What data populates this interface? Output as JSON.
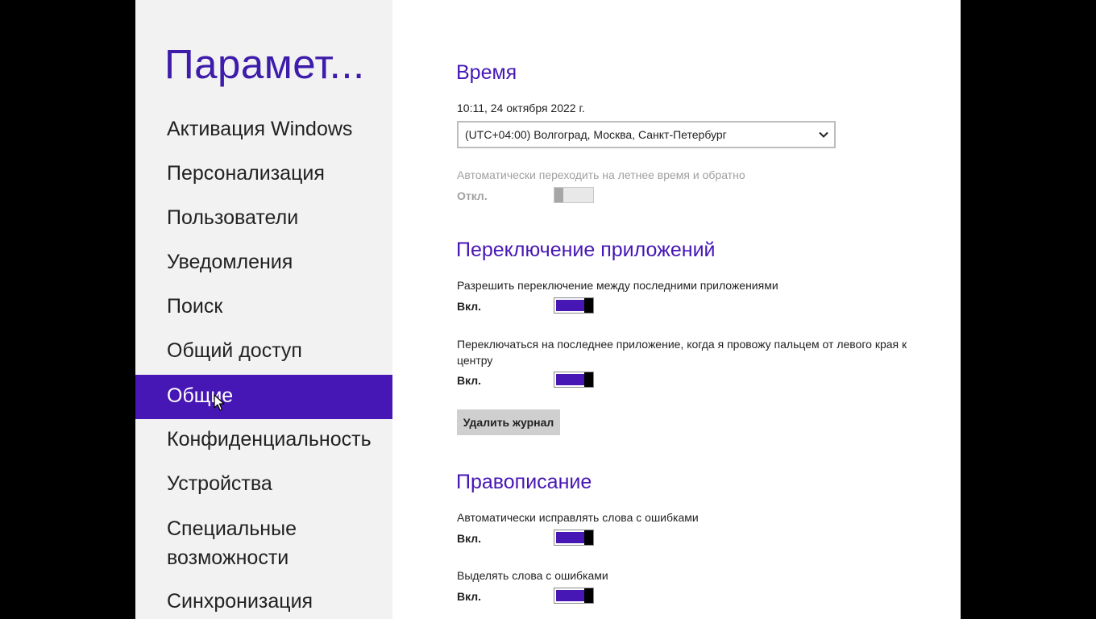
{
  "nav": {
    "title": "Парамет...",
    "items": [
      {
        "label": "Активация Windows"
      },
      {
        "label": "Персонализация"
      },
      {
        "label": "Пользователи"
      },
      {
        "label": "Уведомления"
      },
      {
        "label": "Поиск"
      },
      {
        "label": "Общий доступ"
      },
      {
        "label": "Общие",
        "selected": true
      },
      {
        "label": "Конфиденциальность"
      },
      {
        "label": "Устройства"
      },
      {
        "label": "Специальные возможности"
      },
      {
        "label": "Синхронизация"
      }
    ]
  },
  "time": {
    "heading": "Время",
    "current": "10:11, 24 октября 2022 г.",
    "timezone": "(UTC+04:00) Волгоград, Москва, Санкт-Петербург",
    "dst_label": "Автоматически переходить на летнее время и обратно",
    "dst_state": "Откл."
  },
  "app_switch": {
    "heading": "Переключение приложений",
    "allow_label": "Разрешить переключение между последними приложениями",
    "allow_state": "Вкл.",
    "swipe_label": "Переключаться на последнее приложение, когда я провожу пальцем от левого края к центру",
    "swipe_state": "Вкл.",
    "clear_button": "Удалить журнал"
  },
  "spelling": {
    "heading": "Правописание",
    "autocorrect_label": "Автоматически исправлять слова с ошибками",
    "autocorrect_state": "Вкл.",
    "highlight_label": "Выделять слова с ошибками",
    "highlight_state": "Вкл."
  },
  "colors": {
    "accent": "#4617b4",
    "nav_background": "#f2f2f2",
    "content_background": "#ffffff"
  }
}
